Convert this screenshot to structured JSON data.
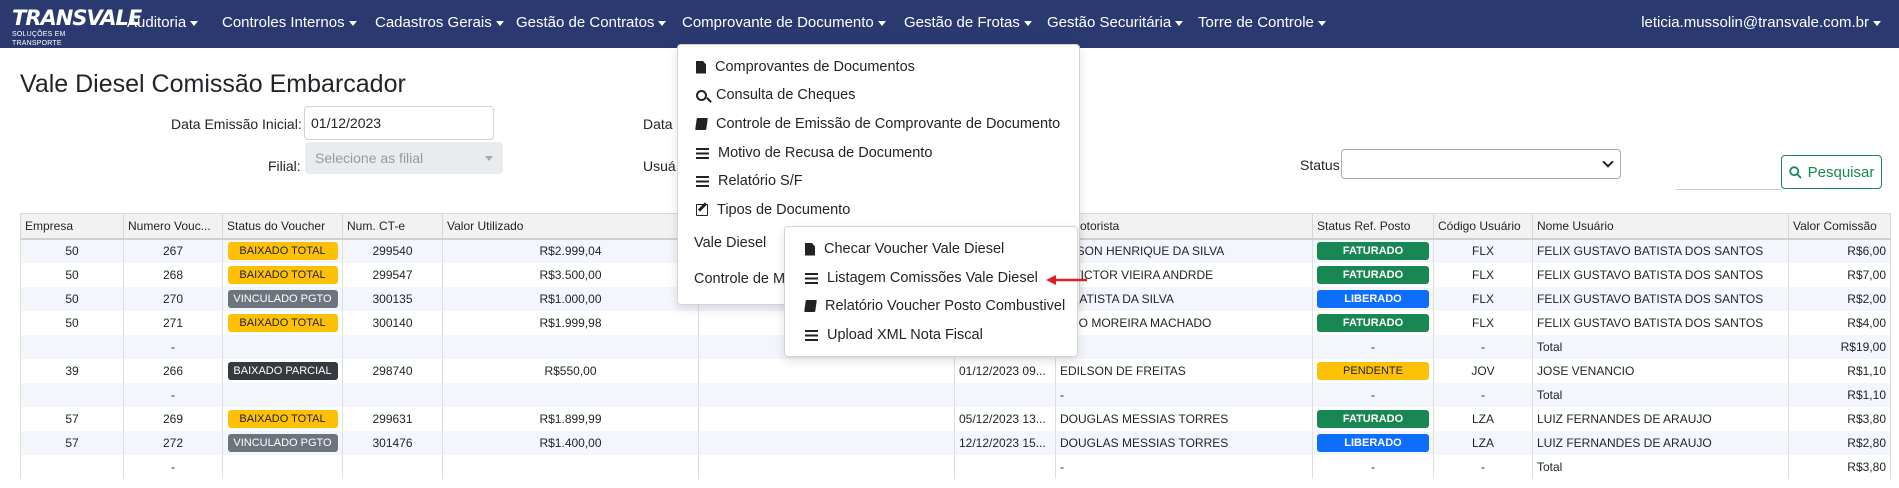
{
  "brand": {
    "name": "TRANSVALE",
    "tagline": "SOLUÇÕES EM TRANSPORTE"
  },
  "nav": {
    "items": [
      "Auditoria",
      "Controles Internos",
      "Cadastros Gerais",
      "Gestão de Contratos",
      "Comprovante de Documento",
      "Gestão de Frotas",
      "Gestão Securitária",
      "Torre de Controle"
    ],
    "user": "leticia.mussolin@transvale.com.br"
  },
  "page": {
    "title": "Vale Diesel Comissão Embarcador"
  },
  "filters": {
    "data_inicial_label": "Data Emissão Inicial:",
    "data_inicial_value": "01/12/2023",
    "data_final_label": "Data",
    "filial_label": "Filial:",
    "filial_placeholder": "Selecione as filial",
    "usuario_label": "Usuá",
    "status_label": "Status:",
    "search_button": "Pesquisar"
  },
  "dropdown": {
    "items": [
      {
        "label": "Comprovantes de Documentos",
        "icon": "file-icon"
      },
      {
        "label": "Consulta de Cheques",
        "icon": "search-icon"
      },
      {
        "label": "Controle de Emissão de Comprovante de Documento",
        "icon": "book-icon"
      },
      {
        "label": "Motivo de Recusa de Documento",
        "icon": "list-icon"
      },
      {
        "label": "Relatório S/F",
        "icon": "list-icon"
      },
      {
        "label": "Tipos de Documento",
        "icon": "edit-icon"
      },
      {
        "label": "Vale Diesel",
        "icon": "caret-right-icon"
      },
      {
        "label": "Controle de M",
        "icon": ""
      }
    ],
    "submenu": [
      {
        "label": "Checar Voucher Vale Diesel",
        "icon": "file-icon"
      },
      {
        "label": "Listagem Comissões Vale Diesel",
        "icon": "list-icon"
      },
      {
        "label": "Relatório Voucher Posto Combustivel",
        "icon": "book-icon"
      },
      {
        "label": "Upload XML Nota Fiscal",
        "icon": "list-icon"
      }
    ]
  },
  "table": {
    "columns": [
      "Empresa",
      "Numero Vouc...",
      "Status do Voucher",
      "Num. CT-e",
      "Valor Utilizado",
      "",
      "",
      "e Motorista",
      "Status Ref. Posto",
      "Código Usuário",
      "Nome Usuário",
      "Valor Comissão"
    ],
    "rows": [
      {
        "empresa": "50",
        "voucher": "267",
        "status": "BAIXADO TOTAL",
        "cte": "299540",
        "valor": "R$2.999,04",
        "data": "",
        "motorista": "ERSON HENRIQUE DA SILVA",
        "posto": "FATURADO",
        "codigo": "FLX",
        "usuario": "FELIX GUSTAVO BATISTA DOS SANTOS",
        "comissao": "R$6,00"
      },
      {
        "empresa": "50",
        "voucher": "268",
        "status": "BAIXADO TOTAL",
        "cte": "299547",
        "valor": "R$3.500,00",
        "data": "",
        "motorista": "O VICTOR VIEIRA ANDRDE",
        "posto": "FATURADO",
        "codigo": "FLX",
        "usuario": "FELIX GUSTAVO BATISTA DOS SANTOS",
        "comissao": "R$7,00"
      },
      {
        "empresa": "50",
        "voucher": "270",
        "status": "VINCULADO PGTO",
        "cte": "300135",
        "valor": "R$1.000,00",
        "data": "",
        "motorista": "S BATISTA DA SILVA",
        "posto": "LIBERADO",
        "codigo": "FLX",
        "usuario": "FELIX GUSTAVO BATISTA DOS SANTOS",
        "comissao": "R$2,00"
      },
      {
        "empresa": "50",
        "voucher": "271",
        "status": "BAIXADO TOTAL",
        "cte": "300140",
        "valor": "R$1.999,98",
        "data": "",
        "motorista": "ILDO MOREIRA MACHADO",
        "posto": "FATURADO",
        "codigo": "FLX",
        "usuario": "FELIX GUSTAVO BATISTA DOS SANTOS",
        "comissao": "R$4,00"
      },
      {
        "empresa": "",
        "voucher": "-",
        "status": "",
        "cte": "",
        "valor": "",
        "data": "",
        "motorista": "",
        "posto": "",
        "codigo": "-",
        "usuario": "Total",
        "comissao": "R$19,00",
        "posto_text": "-"
      },
      {
        "empresa": "39",
        "voucher": "266",
        "status": "BAIXADO PARCIAL",
        "cte": "298740",
        "valor": "R$550,00",
        "data": "01/12/2023 09...",
        "motorista": "EDILSON DE FREITAS",
        "posto": "PENDENTE",
        "codigo": "JOV",
        "usuario": "JOSE VENANCIO",
        "comissao": "R$1,10"
      },
      {
        "empresa": "",
        "voucher": "-",
        "status": "",
        "cte": "",
        "valor": "",
        "data": "",
        "motorista": "-",
        "posto": "",
        "codigo": "-",
        "usuario": "Total",
        "comissao": "R$1,10",
        "posto_text": "-"
      },
      {
        "empresa": "57",
        "voucher": "269",
        "status": "BAIXADO TOTAL",
        "cte": "299631",
        "valor": "R$1.899,99",
        "data": "05/12/2023 13...",
        "motorista": "DOUGLAS MESSIAS TORRES",
        "posto": "FATURADO",
        "codigo": "LZA",
        "usuario": "LUIZ FERNANDES DE ARAUJO",
        "comissao": "R$3,80"
      },
      {
        "empresa": "57",
        "voucher": "272",
        "status": "VINCULADO PGTO",
        "cte": "301476",
        "valor": "R$1.400,00",
        "data": "12/12/2023 15...",
        "motorista": "DOUGLAS MESSIAS TORRES",
        "posto": "LIBERADO",
        "codigo": "LZA",
        "usuario": "LUIZ FERNANDES DE ARAUJO",
        "comissao": "R$2,80"
      },
      {
        "empresa": "",
        "voucher": "-",
        "status": "",
        "cte": "",
        "valor": "",
        "data": "",
        "motorista": "-",
        "posto": "",
        "codigo": "-",
        "usuario": "Total",
        "comissao": "R$3,80",
        "posto_text": "-"
      }
    ]
  }
}
